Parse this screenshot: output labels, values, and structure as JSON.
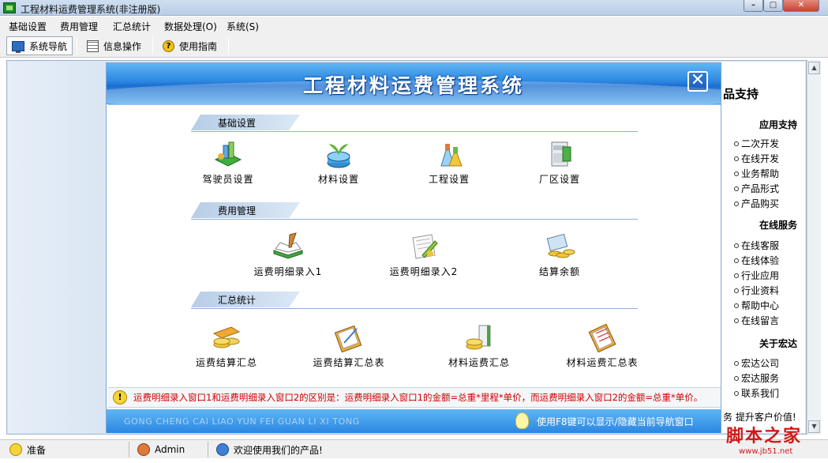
{
  "window": {
    "title": "工程材料运费管理系统(非注册版)",
    "minimize_glyph": "–",
    "maximize_glyph": "□",
    "close_glyph": "✕"
  },
  "menubar": {
    "items": [
      "基础设置",
      "费用管理",
      "汇总统计",
      "数据处理(O)",
      "系统(S)"
    ]
  },
  "toolbar": {
    "buttons": [
      {
        "label": "系统导航",
        "icon": "monitor-icon",
        "active": true
      },
      {
        "label": "信息操作",
        "icon": "grid-icon",
        "active": false
      },
      {
        "label": "使用指南",
        "icon": "help-icon",
        "active": false
      }
    ]
  },
  "navigator": {
    "title": "工程材料运费管理系统",
    "close_glyph": "✕",
    "sections": [
      {
        "label": "基础设置",
        "items": [
          "驾驶员设置",
          "材料设置",
          "工程设置",
          "厂区设置"
        ]
      },
      {
        "label": "费用管理",
        "items": [
          "运费明细录入1",
          "运费明细录入2",
          "结算余额"
        ]
      },
      {
        "label": "汇总统计",
        "items": [
          "运费结算汇总",
          "运费结算汇总表",
          "材料运费汇总",
          "材料运费汇总表"
        ]
      }
    ],
    "tip": "运费明细录入窗口1和运费明细录入窗口2的区别是：运费明细录入窗口1的金额=总重*里程*单价，而运费明细录入窗口2的金额=总重*单价。",
    "footer_pinyin": "GONG CHENG CAI LIAO YUN FEI GUAN LI XI TONG",
    "footer_hint": "使用F8键可以显示/隐藏当前导航窗口"
  },
  "right_panel": {
    "title": "品支持",
    "sections": [
      {
        "label": "应用支持",
        "links": [
          "二次开发",
          "在线开发",
          "业务帮助",
          "产品形式",
          "产品购买"
        ]
      },
      {
        "label": "在线服务",
        "links": [
          "在线客服",
          "在线体验",
          "行业应用",
          "行业资料",
          "帮助中心",
          "在线留言"
        ]
      },
      {
        "label": "关于宏达",
        "links": [
          "宏达公司",
          "宏达服务",
          "联系我们"
        ]
      }
    ],
    "footer": "务 提升客户价值!"
  },
  "statusbar": {
    "ready": "准备",
    "user": "Admin",
    "welcome": "欢迎使用我们的产品!"
  },
  "watermark": {
    "text": "脚本之家",
    "url": "www.jb51.net"
  },
  "colors": {
    "header_blue": "#2b86e0",
    "tip_red": "#d00000",
    "watermark_red": "#d01818"
  }
}
